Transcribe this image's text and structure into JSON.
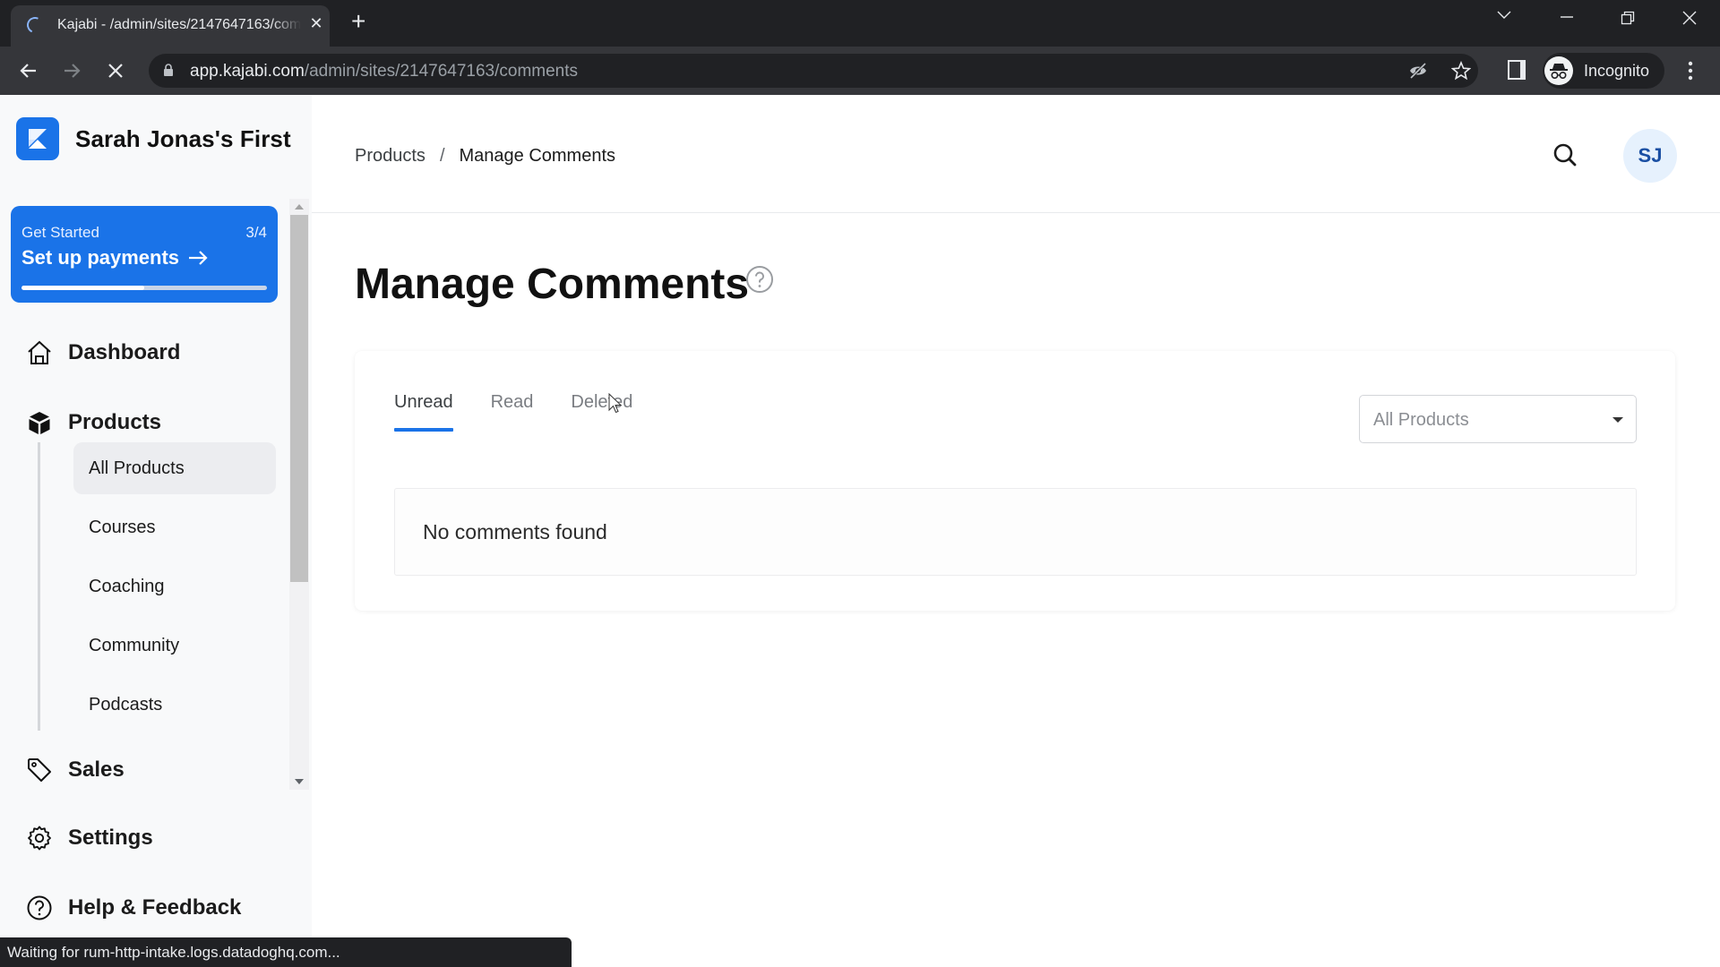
{
  "browser": {
    "tab_title": "Kajabi - /admin/sites/2147647163/comments",
    "url_host": "app.kajabi.com",
    "url_path": "/admin/sites/2147647163/comments",
    "profile_label": "Incognito",
    "status_text": "Waiting for rum-http-intake.logs.datadoghq.com..."
  },
  "sidebar": {
    "brand_name": "Sarah Jonas's First",
    "get_started": {
      "label": "Get Started",
      "count": "3/4",
      "title": "Set up payments",
      "progress_fraction": 0.5
    },
    "items": [
      {
        "label": "Dashboard",
        "icon": "home-icon"
      },
      {
        "label": "Products",
        "icon": "box-icon"
      },
      {
        "label": "Sales",
        "icon": "tag-icon"
      },
      {
        "label": "Settings",
        "icon": "gear-icon"
      },
      {
        "label": "Help & Feedback",
        "icon": "help-circle-icon"
      }
    ],
    "product_subitems": [
      {
        "label": "All Products",
        "active": true
      },
      {
        "label": "Courses"
      },
      {
        "label": "Coaching"
      },
      {
        "label": "Community"
      },
      {
        "label": "Podcasts"
      }
    ]
  },
  "header": {
    "breadcrumb": [
      {
        "label": "Products"
      },
      {
        "label": "Manage Comments"
      }
    ],
    "breadcrumb_separator": "/",
    "avatar_initials": "SJ"
  },
  "main": {
    "title": "Manage Comments",
    "tabs": [
      {
        "label": "Unread",
        "active": true
      },
      {
        "label": "Read"
      },
      {
        "label": "Deleted"
      }
    ],
    "filter": {
      "selected": "All Products"
    },
    "empty_message": "No comments found"
  },
  "colors": {
    "accent": "#1a73e8",
    "avatar_bg": "#e6f1fd",
    "avatar_text": "#1a4fa3"
  }
}
